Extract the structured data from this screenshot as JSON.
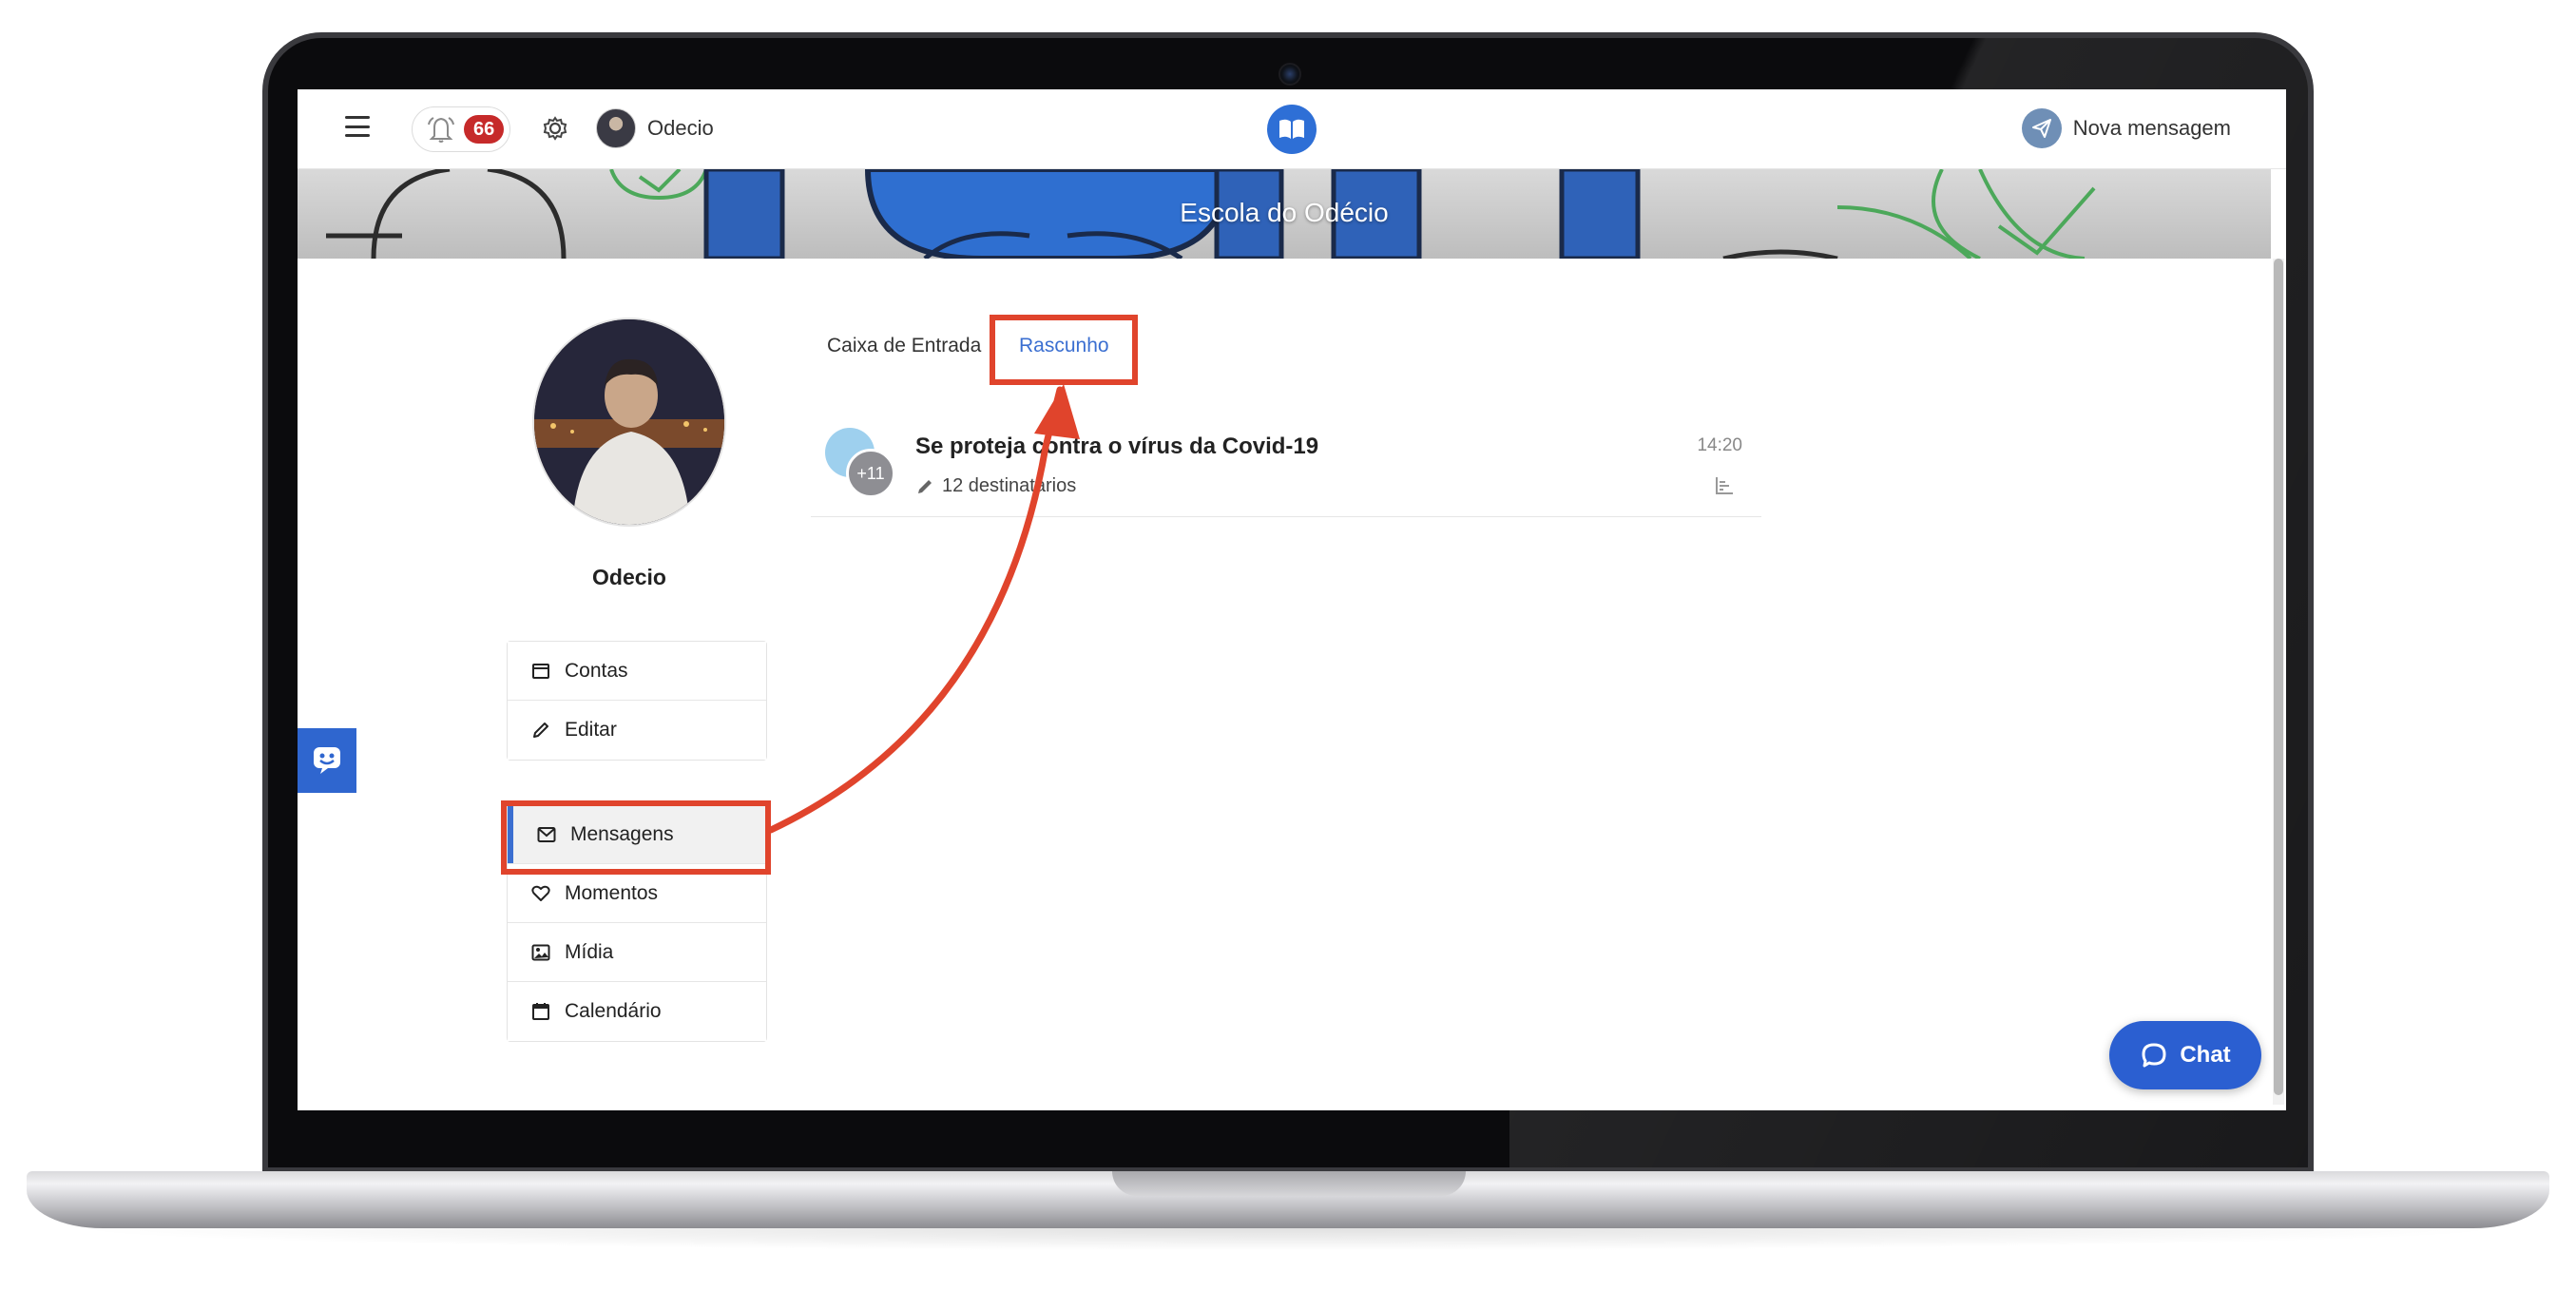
{
  "header": {
    "notification_count": "66",
    "user_name": "Odecio",
    "new_message_label": "Nova mensagem"
  },
  "banner": {
    "school_name": "Escola do Odécio"
  },
  "profile": {
    "name": "Odecio"
  },
  "menu_top": [
    {
      "label": "Contas",
      "icon": "calendar-blank-icon"
    },
    {
      "label": "Editar",
      "icon": "pencil-icon"
    }
  ],
  "menu_bottom": [
    {
      "label": "Mensagens",
      "icon": "envelope-icon",
      "active": true
    },
    {
      "label": "Momentos",
      "icon": "heart-icon"
    },
    {
      "label": "Mídia",
      "icon": "image-icon"
    },
    {
      "label": "Calendário",
      "icon": "calendar-icon"
    }
  ],
  "tabs": [
    {
      "label": "Caixa de Entrada"
    },
    {
      "label": "Rascunho",
      "active": true
    }
  ],
  "messages": [
    {
      "subject": "Se proteja contra o vírus da Covid-19",
      "recipients": "12 destinatários",
      "time": "14:20",
      "avatar_badge": "+11"
    }
  ],
  "chat": {
    "label": "Chat"
  },
  "colors": {
    "accent": "#3b6fd1",
    "annotation": "#e0442c",
    "badge": "#c62a2a"
  }
}
